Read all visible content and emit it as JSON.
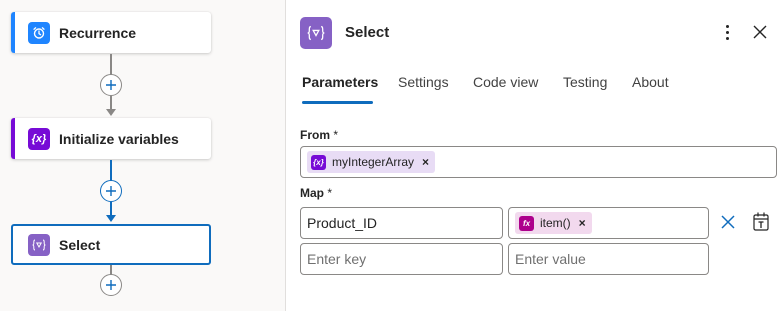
{
  "canvas": {
    "actions": [
      {
        "label": "Recurrence",
        "icon": "alarm-clock-icon",
        "color": "#1f85ff"
      },
      {
        "label": "Initialize variables",
        "icon": "variable-icon",
        "color": "#770bd6"
      },
      {
        "label": "Select",
        "icon": "select-data-operation-icon",
        "color": "#8661c5"
      }
    ],
    "colors": {
      "connector_gray": "#8a8886",
      "connector_blue": "#0f6cbd"
    }
  },
  "panel": {
    "title": "Select",
    "icon": "select-data-operation-icon",
    "tabs": [
      "Parameters",
      "Settings",
      "Code view",
      "Testing",
      "About"
    ],
    "active_tab": "Parameters",
    "from": {
      "label": "From",
      "required_mark": "*",
      "token": {
        "text": "myIntegerArray",
        "icon": "variable-icon",
        "color": "#770bd6",
        "remove": "×"
      }
    },
    "map": {
      "label": "Map",
      "required_mark": "*",
      "row1": {
        "key": "Product_ID",
        "value_token": {
          "text": "item()",
          "icon": "function-icon",
          "color": "#ad008c",
          "remove": "×"
        }
      },
      "row2": {
        "key_placeholder": "Enter key",
        "value_placeholder": "Enter value"
      }
    },
    "accent": "#0f6cbd"
  }
}
